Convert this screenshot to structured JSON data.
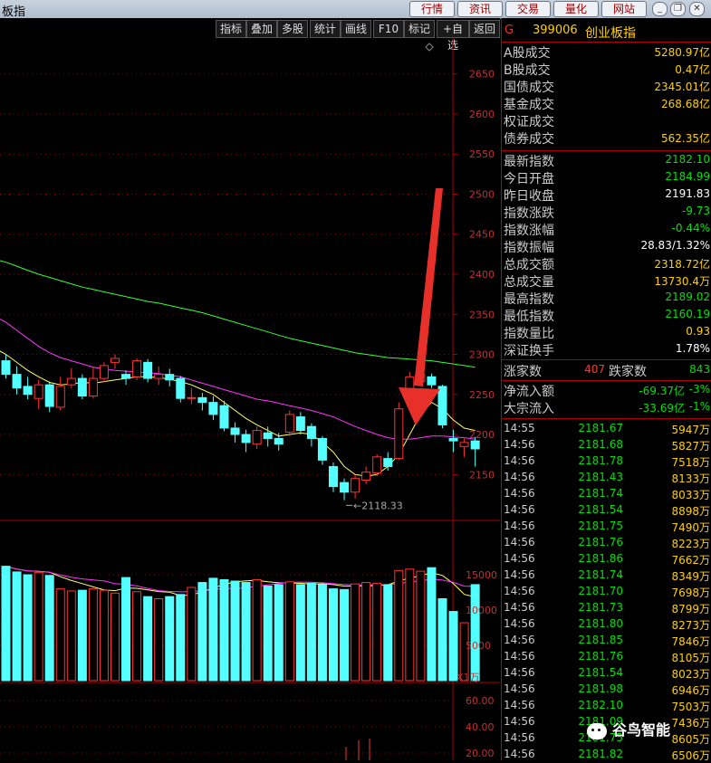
{
  "window": {
    "title": "板指",
    "tabs": [
      "行情",
      "资讯",
      "交易",
      "量化",
      "网站"
    ]
  },
  "toolbar": {
    "buttons": [
      "指标",
      "叠加",
      "多股",
      "统计",
      "画线",
      "F10",
      "标记",
      "+自选",
      "返回"
    ]
  },
  "chart_data": {
    "type": "candlestick",
    "price_axis": [
      "2650",
      "2600",
      "2550",
      "2500",
      "2450",
      "2400",
      "2350",
      "2300",
      "2250",
      "2200",
      "2150"
    ],
    "price_range": [
      2130,
      2670
    ],
    "low_annotation": "2118.33",
    "volume_axis": [
      "15000",
      "10000",
      "5000"
    ],
    "volume_unit": "X1万",
    "indicator_axis": [
      "60.00",
      "40.00",
      "20.00"
    ],
    "candles": [
      {
        "o": 2292,
        "c": 2275,
        "h": 2300,
        "l": 2270
      },
      {
        "o": 2275,
        "c": 2258,
        "h": 2285,
        "l": 2250
      },
      {
        "o": 2260,
        "c": 2250,
        "h": 2272,
        "l": 2244
      },
      {
        "o": 2245,
        "c": 2262,
        "h": 2268,
        "l": 2232
      },
      {
        "o": 2262,
        "c": 2235,
        "h": 2265,
        "l": 2228
      },
      {
        "o": 2234,
        "c": 2260,
        "h": 2272,
        "l": 2230
      },
      {
        "o": 2262,
        "c": 2270,
        "h": 2283,
        "l": 2258
      },
      {
        "o": 2270,
        "c": 2248,
        "h": 2275,
        "l": 2244
      },
      {
        "o": 2248,
        "c": 2270,
        "h": 2285,
        "l": 2245
      },
      {
        "o": 2270,
        "c": 2286,
        "h": 2290,
        "l": 2265
      },
      {
        "o": 2290,
        "c": 2295,
        "h": 2300,
        "l": 2282
      },
      {
        "o": 2275,
        "c": 2270,
        "h": 2280,
        "l": 2262
      },
      {
        "o": 2272,
        "c": 2292,
        "h": 2295,
        "l": 2268
      },
      {
        "o": 2290,
        "c": 2270,
        "h": 2294,
        "l": 2265
      },
      {
        "o": 2270,
        "c": 2275,
        "h": 2285,
        "l": 2262
      },
      {
        "o": 2275,
        "c": 2268,
        "h": 2282,
        "l": 2260
      },
      {
        "o": 2270,
        "c": 2245,
        "h": 2273,
        "l": 2240
      },
      {
        "o": 2245,
        "c": 2246,
        "h": 2258,
        "l": 2238
      },
      {
        "o": 2246,
        "c": 2240,
        "h": 2252,
        "l": 2230
      },
      {
        "o": 2240,
        "c": 2225,
        "h": 2248,
        "l": 2218
      },
      {
        "o": 2236,
        "c": 2208,
        "h": 2242,
        "l": 2204
      },
      {
        "o": 2208,
        "c": 2200,
        "h": 2215,
        "l": 2190
      },
      {
        "o": 2200,
        "c": 2190,
        "h": 2206,
        "l": 2178
      },
      {
        "o": 2188,
        "c": 2205,
        "h": 2210,
        "l": 2182
      },
      {
        "o": 2202,
        "c": 2195,
        "h": 2210,
        "l": 2185
      },
      {
        "o": 2195,
        "c": 2188,
        "h": 2202,
        "l": 2180
      },
      {
        "o": 2203,
        "c": 2225,
        "h": 2230,
        "l": 2198
      },
      {
        "o": 2222,
        "c": 2205,
        "h": 2228,
        "l": 2200
      },
      {
        "o": 2210,
        "c": 2195,
        "h": 2214,
        "l": 2185
      },
      {
        "o": 2195,
        "c": 2168,
        "h": 2198,
        "l": 2162
      },
      {
        "o": 2160,
        "c": 2135,
        "h": 2165,
        "l": 2128
      },
      {
        "o": 2140,
        "c": 2128,
        "h": 2145,
        "l": 2118
      },
      {
        "o": 2128,
        "c": 2145,
        "h": 2150,
        "l": 2120
      },
      {
        "o": 2143,
        "c": 2153,
        "h": 2160,
        "l": 2138
      },
      {
        "o": 2152,
        "c": 2172,
        "h": 2175,
        "l": 2148
      },
      {
        "o": 2170,
        "c": 2160,
        "h": 2178,
        "l": 2155
      },
      {
        "o": 2170,
        "c": 2232,
        "h": 2240,
        "l": 2168
      },
      {
        "o": 2245,
        "c": 2272,
        "h": 2278,
        "l": 2240
      },
      {
        "o": 2266,
        "c": 2275,
        "h": 2279,
        "l": 2262
      },
      {
        "o": 2272,
        "c": 2262,
        "h": 2276,
        "l": 2258
      },
      {
        "o": 2260,
        "c": 2212,
        "h": 2262,
        "l": 2208
      },
      {
        "o": 2195,
        "c": 2192,
        "h": 2206,
        "l": 2178
      },
      {
        "o": 2185,
        "c": 2190,
        "h": 2195,
        "l": 2172
      },
      {
        "o": 2192,
        "c": 2182,
        "h": 2197,
        "l": 2160
      }
    ],
    "volumes": [
      16200,
      15400,
      15000,
      15300,
      14900,
      13000,
      12700,
      12800,
      13000,
      12800,
      12400,
      14600,
      12600,
      11900,
      11600,
      11900,
      12200,
      13200,
      13900,
      14500,
      14300,
      14100,
      13900,
      14300,
      13400,
      13600,
      14000,
      13600,
      13800,
      13600,
      13000,
      12900,
      13700,
      13900,
      13800,
      13600,
      15600,
      15800,
      15500,
      16000,
      11600,
      9800,
      8200,
      13600
    ],
    "ma_series": [
      {
        "color": "#ffff66",
        "values": [
          2300,
          2290,
          2280,
          2272,
          2265,
          2262,
          2263,
          2265,
          2264,
          2266,
          2268,
          2270,
          2272,
          2272,
          2271,
          2269,
          2266,
          2262,
          2256,
          2250,
          2240,
          2230,
          2220,
          2212,
          2205,
          2198,
          2200,
          2202,
          2200,
          2190,
          2178,
          2160,
          2150,
          2148,
          2150,
          2160,
          2175,
          2200,
          2225,
          2240,
          2232,
          2218,
          2208,
          2205
        ]
      },
      {
        "color": "#ff33ff",
        "values": [
          2340,
          2330,
          2320,
          2310,
          2302,
          2296,
          2292,
          2288,
          2284,
          2282,
          2280,
          2279,
          2278,
          2277,
          2276,
          2274,
          2272,
          2268,
          2264,
          2260,
          2256,
          2252,
          2248,
          2244,
          2242,
          2239,
          2236,
          2233,
          2230,
          2226,
          2222,
          2216,
          2210,
          2205,
          2200,
          2196,
          2194,
          2194,
          2196,
          2198,
          2198,
          2197,
          2196,
          2194
        ]
      },
      {
        "color": "#33ff33",
        "values": [
          2415,
          2410,
          2405,
          2400,
          2396,
          2392,
          2388,
          2384,
          2381,
          2378,
          2375,
          2372,
          2369,
          2366,
          2364,
          2361,
          2358,
          2355,
          2352,
          2348,
          2344,
          2340,
          2336,
          2332,
          2328,
          2324,
          2320,
          2317,
          2314,
          2311,
          2308,
          2305,
          2302,
          2300,
          2298,
          2296,
          2295,
          2294,
          2293,
          2292,
          2290,
          2288,
          2286,
          2284
        ]
      }
    ]
  },
  "side_panel": {
    "g_label": "G",
    "code": "399006",
    "name": "创业板指",
    "group1": [
      {
        "label": "A股成交",
        "value": "5280.97亿",
        "color": "#ffd000"
      },
      {
        "label": "B股成交",
        "value": "0.47亿",
        "color": "#ffd000"
      },
      {
        "label": "国债成交",
        "value": "2345.01亿",
        "color": "#ffd000"
      },
      {
        "label": "基金成交",
        "value": "268.68亿",
        "color": "#ffd000"
      },
      {
        "label": "权证成交",
        "value": "",
        "color": "#ffd000"
      },
      {
        "label": "债券成交",
        "value": "562.35亿",
        "color": "#ffd000"
      }
    ],
    "group2": [
      {
        "label": "最新指数",
        "value": "2182.10",
        "color": "#00e000"
      },
      {
        "label": "今日开盘",
        "value": "2184.99",
        "color": "#00e000"
      },
      {
        "label": "昨日收盘",
        "value": "2191.83",
        "color": "#ffffff"
      },
      {
        "label": "指数涨跌",
        "value": "-9.73",
        "color": "#00e000"
      },
      {
        "label": "指数涨幅",
        "value": "-0.44%",
        "color": "#00e000"
      },
      {
        "label": "指数振幅",
        "value": "28.83/1.32%",
        "color": "#ffffff"
      },
      {
        "label": "总成交额",
        "value": "2318.72亿",
        "color": "#ffd000"
      },
      {
        "label": "总成交量",
        "value": "13730.4万",
        "color": "#ffd000"
      },
      {
        "label": "最高指数",
        "value": "2189.02",
        "color": "#00e000"
      },
      {
        "label": "最低指数",
        "value": "2160.19",
        "color": "#00e000"
      },
      {
        "label": "指数量比",
        "value": "0.93",
        "color": "#ffd000"
      },
      {
        "label": "深证换手",
        "value": "1.78%",
        "color": "#ffffff"
      }
    ],
    "updown": {
      "up_label": "涨家数",
      "up_value": "407",
      "down_label": "跌家数",
      "down_value": "843"
    },
    "flows": [
      {
        "label": "净流入额",
        "value": "-69.37亿",
        "pct": "-3%"
      },
      {
        "label": "大宗流入",
        "value": "-33.69亿",
        "pct": "-1%"
      }
    ],
    "ticks": [
      {
        "time": "14:55",
        "price": "2181.67",
        "vol": "5947万"
      },
      {
        "time": "14:56",
        "price": "2181.68",
        "vol": "5827万"
      },
      {
        "time": "14:56",
        "price": "2181.78",
        "vol": "7518万"
      },
      {
        "time": "14:56",
        "price": "2181.43",
        "vol": "8133万"
      },
      {
        "time": "14:56",
        "price": "2181.74",
        "vol": "8033万"
      },
      {
        "time": "14:56",
        "price": "2181.54",
        "vol": "8898万"
      },
      {
        "time": "14:56",
        "price": "2181.75",
        "vol": "7490万"
      },
      {
        "time": "14:56",
        "price": "2181.76",
        "vol": "8223万"
      },
      {
        "time": "14:56",
        "price": "2181.86",
        "vol": "7662万"
      },
      {
        "time": "14:56",
        "price": "2181.74",
        "vol": "8349万"
      },
      {
        "time": "14:56",
        "price": "2181.70",
        "vol": "7698万"
      },
      {
        "time": "14:56",
        "price": "2181.73",
        "vol": "8799万"
      },
      {
        "time": "14:56",
        "price": "2181.80",
        "vol": "8273万"
      },
      {
        "time": "14:56",
        "price": "2181.85",
        "vol": "7846万"
      },
      {
        "time": "14:56",
        "price": "2181.76",
        "vol": "8105万"
      },
      {
        "time": "14:56",
        "price": "2181.54",
        "vol": "8023万"
      },
      {
        "time": "14:56",
        "price": "2181.98",
        "vol": "6946万"
      },
      {
        "time": "14:56",
        "price": "2182.10",
        "vol": "7503万"
      },
      {
        "time": "14:56",
        "price": "2181.09",
        "vol": "7436万"
      },
      {
        "time": "14:56",
        "price": "2181.75",
        "vol": "8605万"
      },
      {
        "time": "14:56",
        "price": "2181.82",
        "vol": "6506万"
      }
    ]
  },
  "watermark": "谷鸟智能"
}
